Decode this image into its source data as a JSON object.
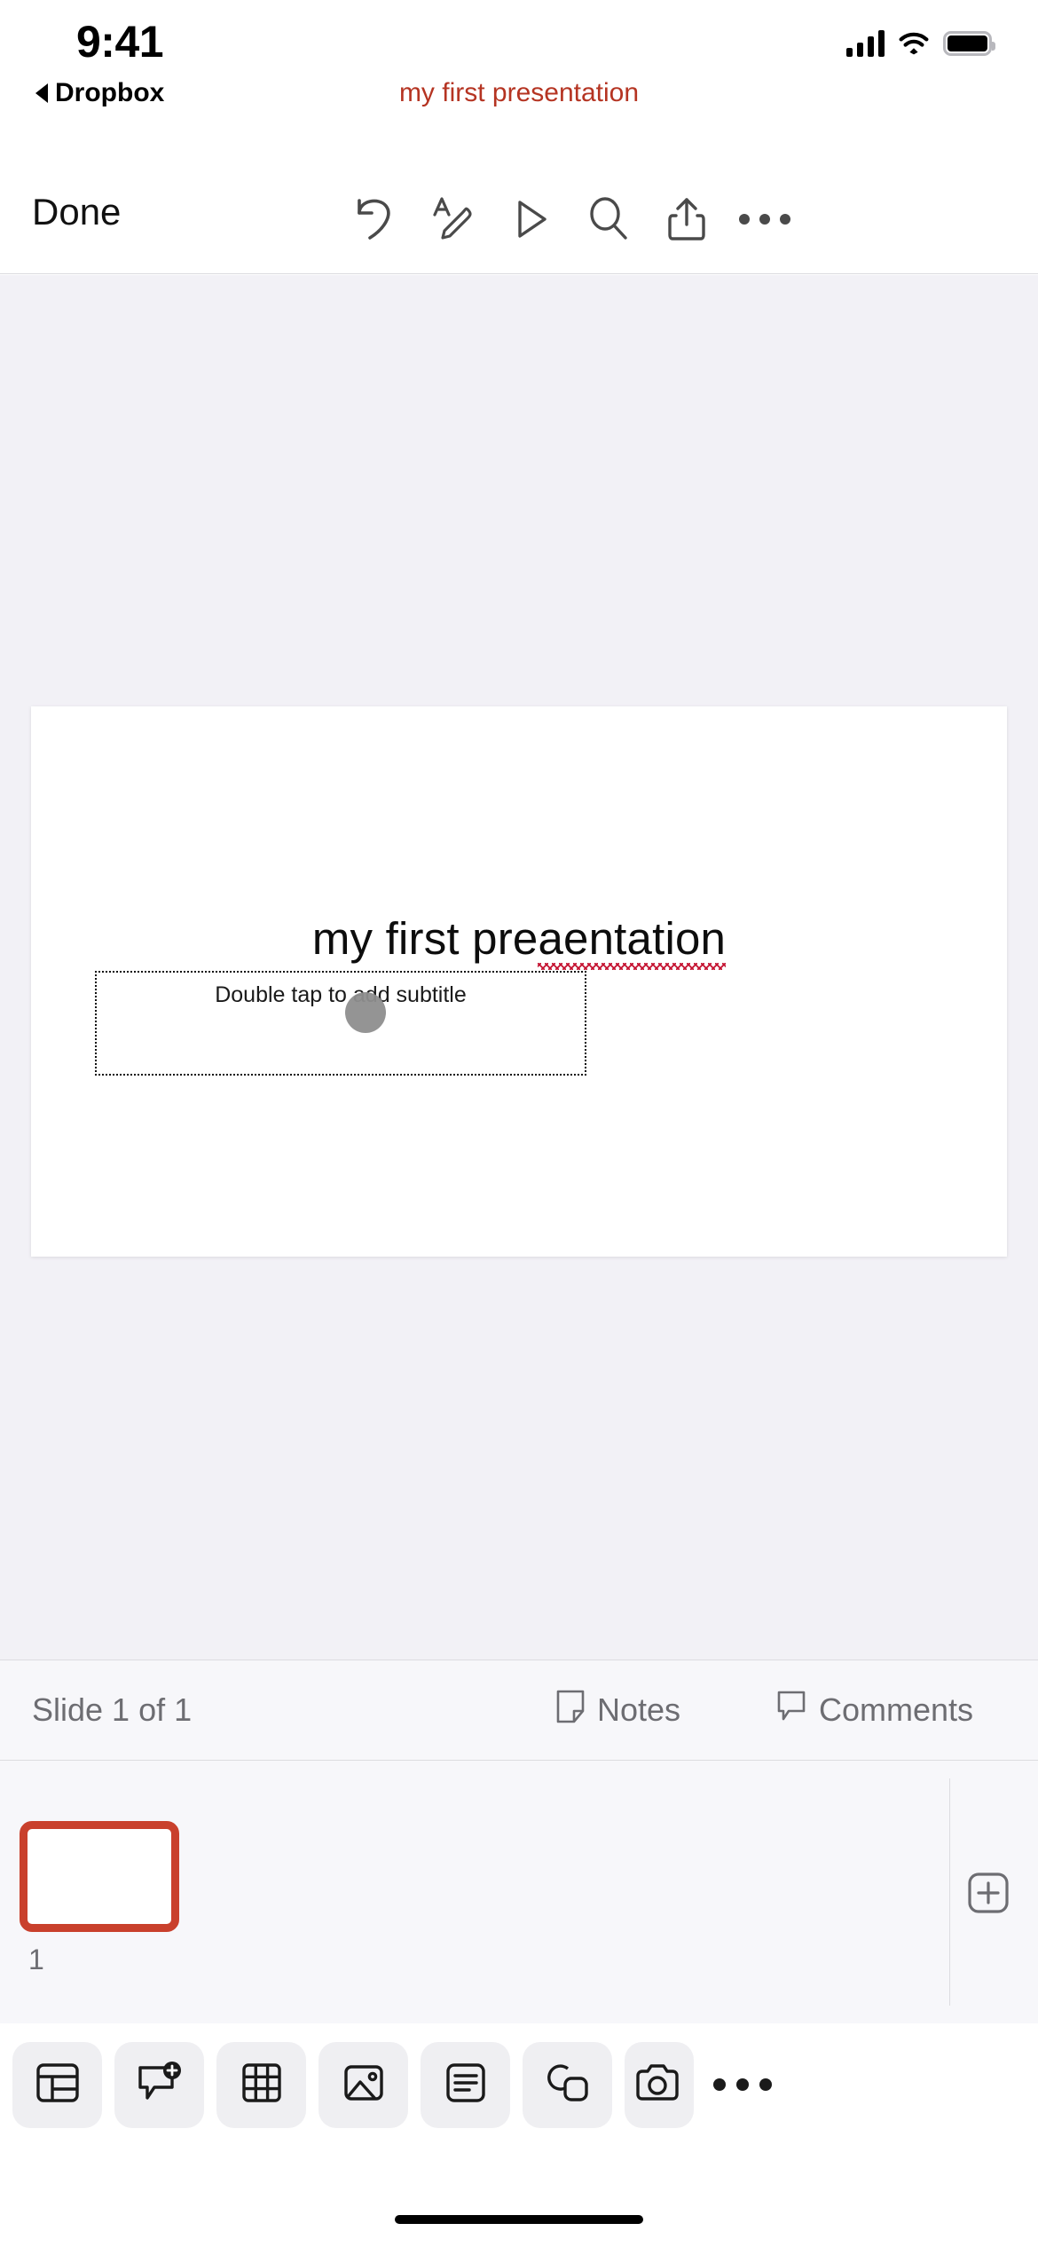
{
  "status_bar": {
    "time": "9:41",
    "icons": [
      "cellular-signal-icon",
      "wifi-icon",
      "battery-icon"
    ]
  },
  "back_bar": {
    "back_label": "Dropbox",
    "back_icon": "back-caret-icon"
  },
  "document": {
    "title": "my first presentation",
    "title_color": "#b53422"
  },
  "toolbar": {
    "done_label": "Done",
    "items": [
      {
        "name": "undo-icon",
        "label": "Undo"
      },
      {
        "name": "format-text-icon",
        "label": "Format"
      },
      {
        "name": "play-icon",
        "label": "Present"
      },
      {
        "name": "search-icon",
        "label": "Search"
      },
      {
        "name": "share-icon",
        "label": "Share"
      },
      {
        "name": "more-icon",
        "label": "More"
      }
    ]
  },
  "slide": {
    "title_text": "my first pre",
    "title_misspelled": "aentation",
    "subtitle_placeholder": "Double tap to add subtitle",
    "spellcheck_color": "#c41230",
    "background": "#ffffff"
  },
  "status_strip": {
    "slide_count_label": "Slide 1 of 1",
    "notes_label": "Notes",
    "notes_icon": "note-page-icon",
    "comments_label": "Comments",
    "comments_icon": "comment-bubble-icon"
  },
  "thumbnails": {
    "selected_index": 1,
    "items": [
      {
        "number": "1"
      }
    ],
    "selection_color": "#c9402c",
    "add_slide_icon": "plus-box-icon"
  },
  "insert_toolbar": {
    "items": [
      {
        "name": "layout-icon",
        "label": "Layout"
      },
      {
        "name": "add-comment-icon",
        "label": "New Comment"
      },
      {
        "name": "table-icon",
        "label": "Table"
      },
      {
        "name": "image-icon",
        "label": "Picture"
      },
      {
        "name": "text-box-icon",
        "label": "Text Box"
      },
      {
        "name": "shapes-icon",
        "label": "Shapes"
      },
      {
        "name": "camera-icon",
        "label": "Camera"
      }
    ],
    "more_icon": "more-icon"
  }
}
